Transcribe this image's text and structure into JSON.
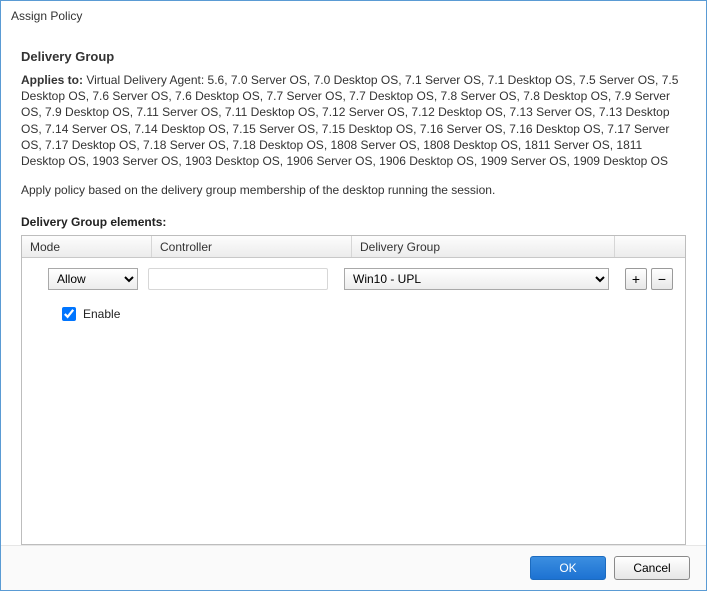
{
  "window": {
    "title": "Assign Policy"
  },
  "section": {
    "header": "Delivery Group"
  },
  "applies": {
    "label": "Applies to:",
    "text": "Virtual Delivery Agent: 5.6, 7.0 Server OS, 7.0 Desktop OS, 7.1 Server OS, 7.1 Desktop OS, 7.5 Server OS, 7.5 Desktop OS, 7.6 Server OS, 7.6 Desktop OS, 7.7 Server OS, 7.7 Desktop OS, 7.8 Server OS, 7.8 Desktop OS, 7.9 Server OS, 7.9 Desktop OS, 7.11 Server OS, 7.11 Desktop OS, 7.12 Server OS, 7.12 Desktop OS, 7.13 Server OS, 7.13 Desktop OS, 7.14 Server OS, 7.14 Desktop OS, 7.15 Server OS, 7.15 Desktop OS, 7.16 Server OS, 7.16 Desktop OS, 7.17 Server OS, 7.17 Desktop OS, 7.18 Server OS, 7.18 Desktop OS, 1808 Server OS, 1808 Desktop OS, 1811 Server OS, 1811 Desktop OS, 1903 Server OS, 1903 Desktop OS, 1906 Server OS, 1906 Desktop OS, 1909 Server OS, 1909 Desktop OS"
  },
  "description": "Apply policy based on the delivery group membership of the desktop running the session.",
  "elements": {
    "label": "Delivery Group elements:",
    "columns": {
      "mode": "Mode",
      "controller": "Controller",
      "delivery_group": "Delivery Group"
    },
    "rows": [
      {
        "mode": "Allow",
        "controller": "",
        "delivery_group": "Win10 - UPL"
      }
    ],
    "enable": {
      "label": "Enable",
      "checked": true
    },
    "add_label": "+",
    "remove_label": "−"
  },
  "footer": {
    "ok": "OK",
    "cancel": "Cancel"
  }
}
